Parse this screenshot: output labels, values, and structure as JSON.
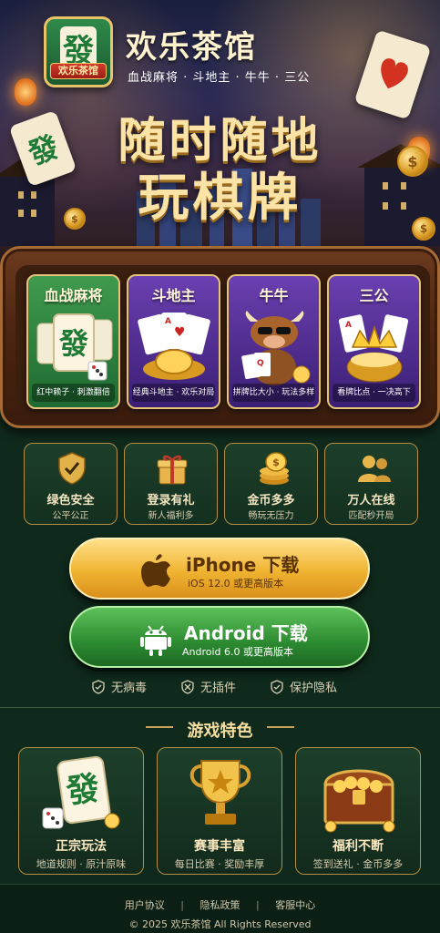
{
  "app": {
    "title": "欢乐茶馆",
    "subtitle": "血战麻将 · 斗地主 · 牛牛 · 三公",
    "logo_glyph": "發",
    "logo_ribbon": "欢乐茶馆"
  },
  "hero": {
    "slogan_line1": "随时随地",
    "slogan_line2": "玩棋牌"
  },
  "games": [
    {
      "name": "血战麻将",
      "desc": "红中赖子 · 刺激翻倍",
      "style": "green"
    },
    {
      "name": "斗地主",
      "desc": "经典斗地主 · 欢乐对局",
      "style": "purple"
    },
    {
      "name": "牛牛",
      "desc": "拼牌比大小 · 玩法多样",
      "style": "purple"
    },
    {
      "name": "三公",
      "desc": "看牌比点 · 一决高下",
      "style": "purple"
    }
  ],
  "features": [
    {
      "title": "绿色安全",
      "sub": "公平公正",
      "icon": "shield-check-icon"
    },
    {
      "title": "登录有礼",
      "sub": "新人福利多",
      "icon": "gift-icon"
    },
    {
      "title": "金币多多",
      "sub": "畅玩无压力",
      "icon": "coins-icon"
    },
    {
      "title": "万人在线",
      "sub": "匹配秒开局",
      "icon": "users-icon"
    }
  ],
  "download": {
    "ios_label": "iPhone 下载",
    "ios_sub": "iOS 12.0 或更高版本",
    "android_label": "Android 下载",
    "android_sub": "Android 6.0 或更高版本"
  },
  "trust": [
    "无病毒",
    "无插件",
    "保护隐私"
  ],
  "game_features": {
    "title": "游戏特色",
    "items": [
      {
        "title": "正宗玩法",
        "sub": "地道规则 · 原汁原味",
        "icon": "mahjong-tile-icon"
      },
      {
        "title": "赛事丰富",
        "sub": "每日比赛 · 奖励丰厚",
        "icon": "trophy-icon"
      },
      {
        "title": "福利不断",
        "sub": "签到送礼 · 金币多多",
        "icon": "treasure-chest-icon"
      }
    ]
  },
  "footer": {
    "links": [
      "用户协议",
      "隐私政策",
      "客服中心"
    ],
    "copyright": "© 2025 欢乐茶馆 All Rights Reserved"
  },
  "colors": {
    "background": "#0f2a1c",
    "gold": "#e9c36a",
    "ios_button": "#f0b431",
    "android_button": "#2c8a30"
  }
}
